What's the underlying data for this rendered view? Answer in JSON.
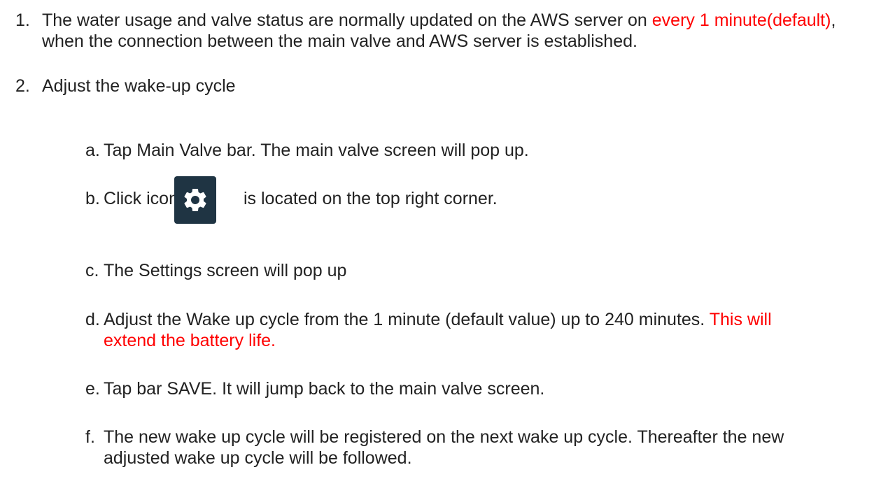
{
  "items": [
    {
      "number": "1.",
      "segments": [
        "The water usage and valve status are normally updated on the AWS server on ",
        "every 1 minute(default)",
        ", when the connection between the main valve and AWS server is established."
      ]
    },
    {
      "number": "2.",
      "text": "Adjust the wake-up cycle"
    }
  ],
  "sub_items": {
    "a": {
      "letter": "a.",
      "text": "Tap Main Valve bar. The main valve screen will pop up."
    },
    "b": {
      "letter": "b.",
      "text_before": "Click icon",
      "icon": "gear-icon",
      "text_after": "is located on the top right corner."
    },
    "c": {
      "letter": "c.",
      "text": "The Settings screen will pop up"
    },
    "d": {
      "letter": "d.",
      "text": "Adjust the Wake up cycle from the 1 minute (default value) up to 240 minutes. ",
      "highlight": "This will extend the battery life."
    },
    "e": {
      "letter": "e.",
      "text": "Tap bar SAVE. It will jump back to the main valve screen."
    },
    "f": {
      "letter": "f.",
      "text": "The new wake up cycle will be registered on the next wake up cycle. Thereafter the new adjusted wake up cycle will be followed."
    }
  },
  "colors": {
    "text": "#222222",
    "highlight": "#ff0000",
    "icon_background": "#1f3443",
    "icon_foreground": "#ffffff"
  }
}
